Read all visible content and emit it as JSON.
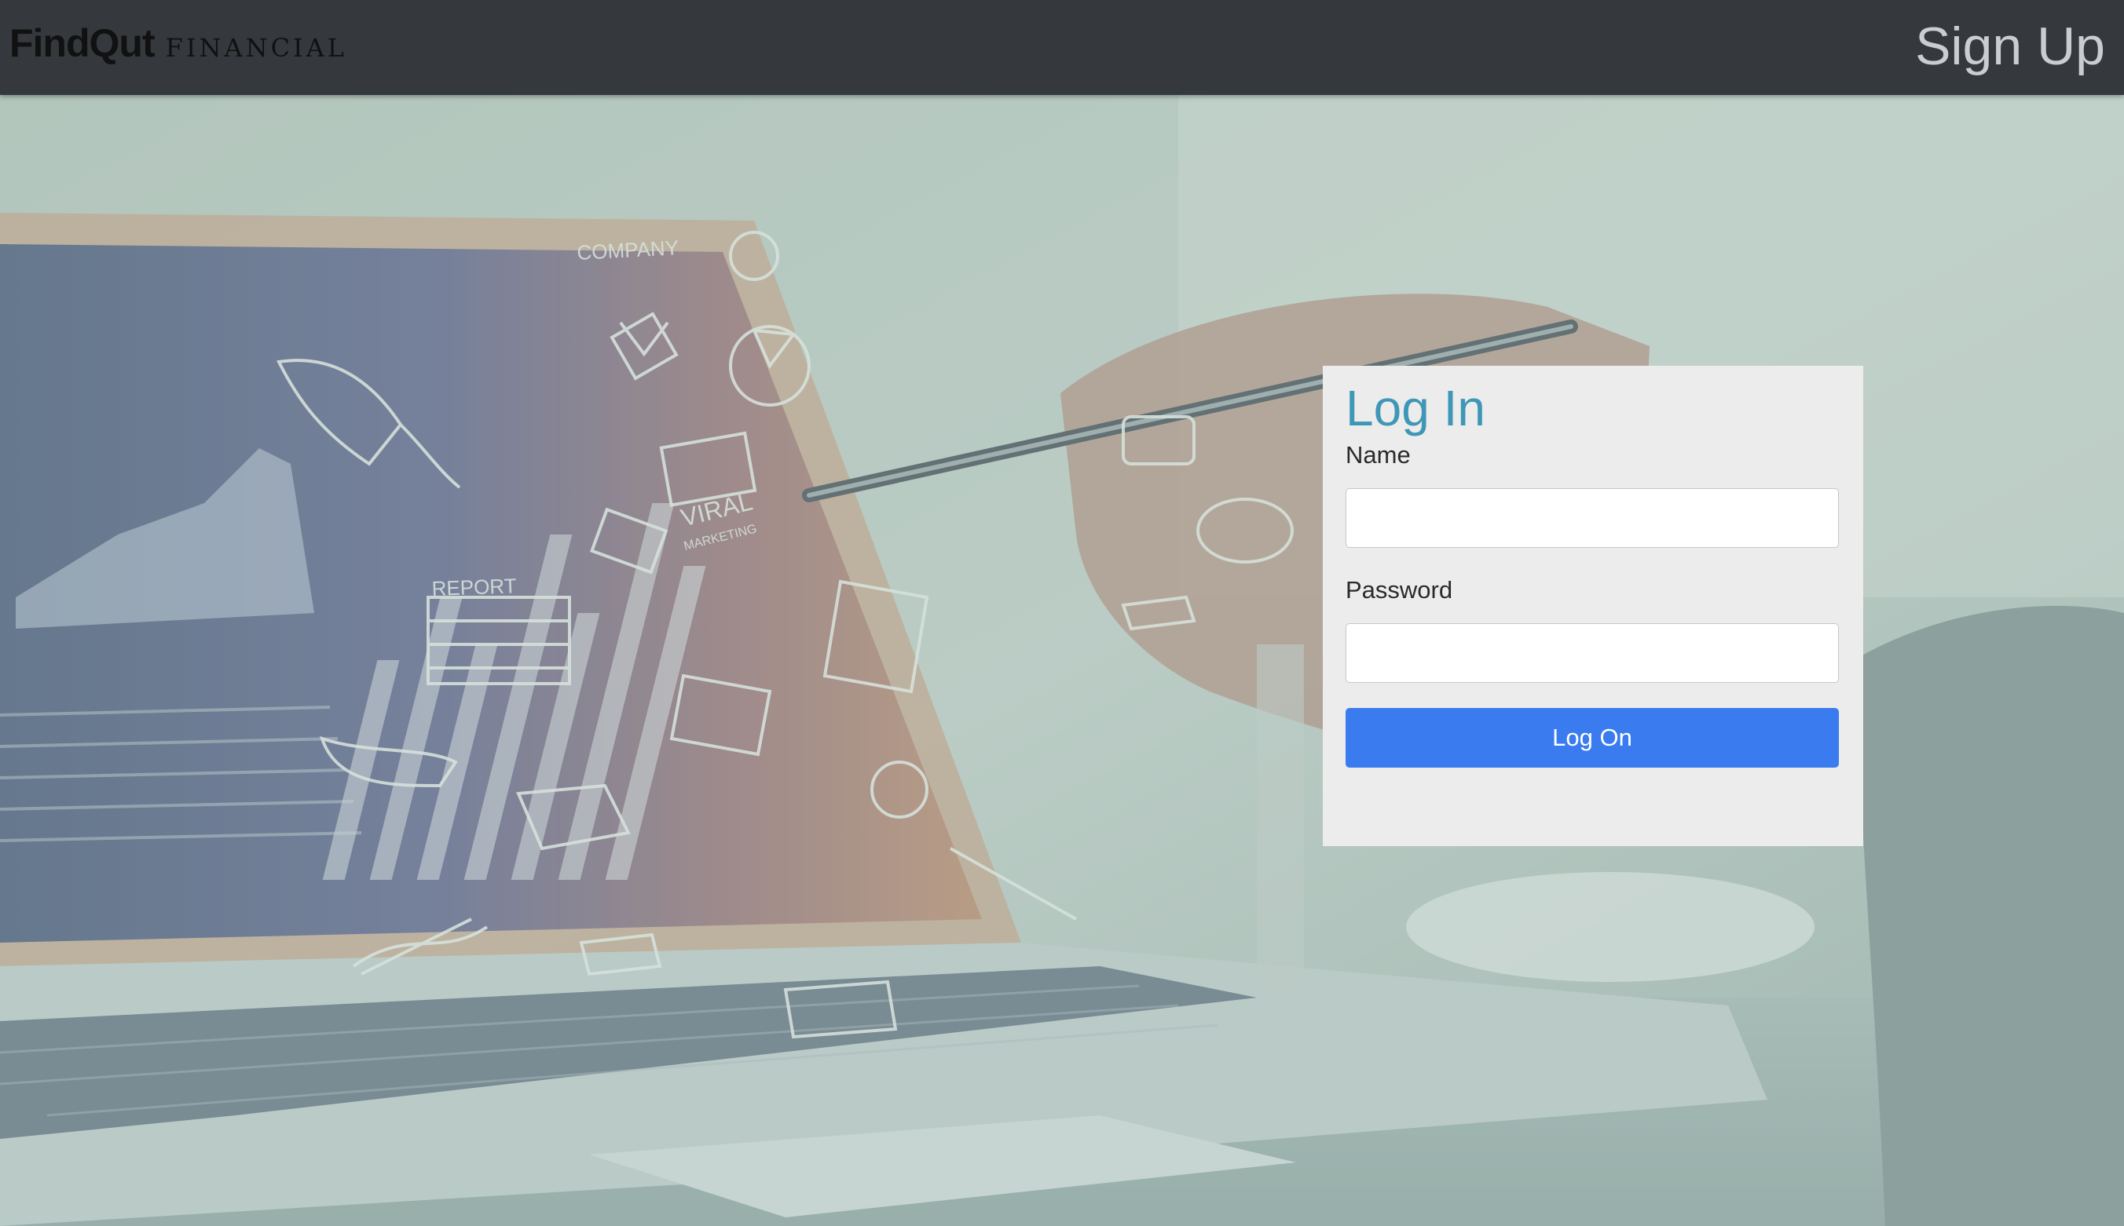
{
  "header": {
    "logo_main": "FindQut",
    "logo_sub": "FINANCIAL",
    "signup_label": "Sign Up"
  },
  "background": {
    "doodle_labels": {
      "company": "COMPANY",
      "report": "REPORT",
      "viral": "VIRAL",
      "marketing": "MARKETING"
    }
  },
  "login": {
    "title": "Log In",
    "name_label": "Name",
    "name_value": "",
    "password_label": "Password",
    "password_value": "",
    "submit_label": "Log On"
  },
  "colors": {
    "header_bg": "#35393d",
    "title_color": "#3e97b6",
    "button_bg": "#3a7bef",
    "card_bg": "#ececec"
  }
}
